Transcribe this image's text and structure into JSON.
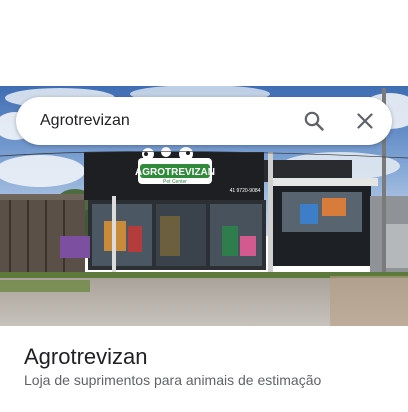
{
  "search": {
    "query": "Agrotrevizan",
    "search_icon": "search-icon",
    "close_icon": "close-icon"
  },
  "photo": {
    "sign_text": "AGROTREVIZAN",
    "sign_subtext": "Pet Center",
    "phone_text": "41 9720-9084"
  },
  "place": {
    "name": "Agrotrevizan",
    "category": "Loja de suprimentos para animais de estimação"
  }
}
